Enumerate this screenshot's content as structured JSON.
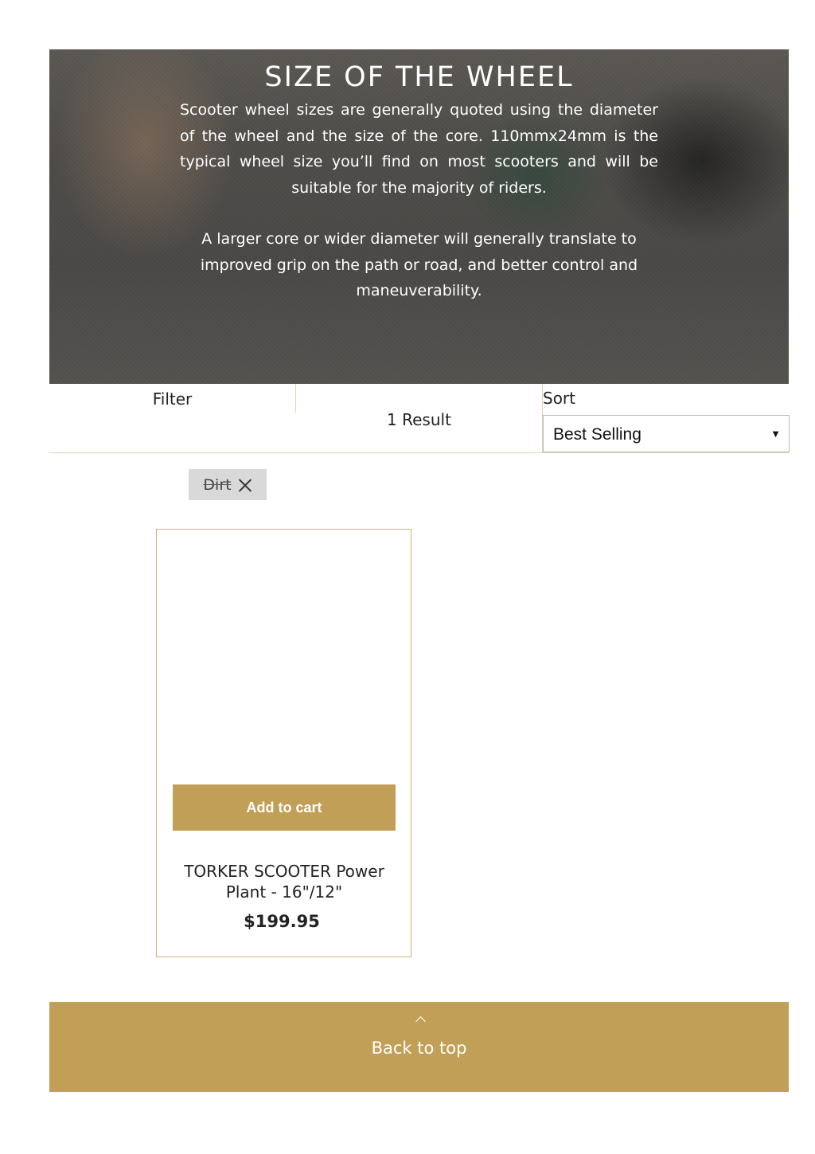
{
  "hero": {
    "title": "SIZE OF THE WHEEL",
    "paragraph1": "Scooter wheel sizes are generally quoted using the diameter of the wheel and the size of the core. 110mmx24mm is the typical wheel size you’ll ﬁnd on most scooters and will be suitable for the majority of riders.",
    "paragraph2": "A larger core or wider diameter will generally translate to improved grip on the path or road, and better control and maneuverability."
  },
  "toolbar": {
    "filter_label": "Filter",
    "result_count": "1 Result",
    "sort_label": "Sort",
    "sort_selected": "Best Selling"
  },
  "active_filters": [
    {
      "label": "Dirt",
      "icon": "close-icon"
    }
  ],
  "products": [
    {
      "title": "TORKER SCOOTER Power Plant - 16\"/12\"",
      "price": "$199.95",
      "add_to_cart_label": "Add to cart"
    }
  ],
  "footer": {
    "back_to_top_label": "Back to top",
    "icon": "chevron-up-icon"
  },
  "colors": {
    "accent": "#c29f56",
    "card_border": "#cdb27a",
    "divider": "#e2d4b4",
    "tag_bg": "#d9d9d9"
  }
}
